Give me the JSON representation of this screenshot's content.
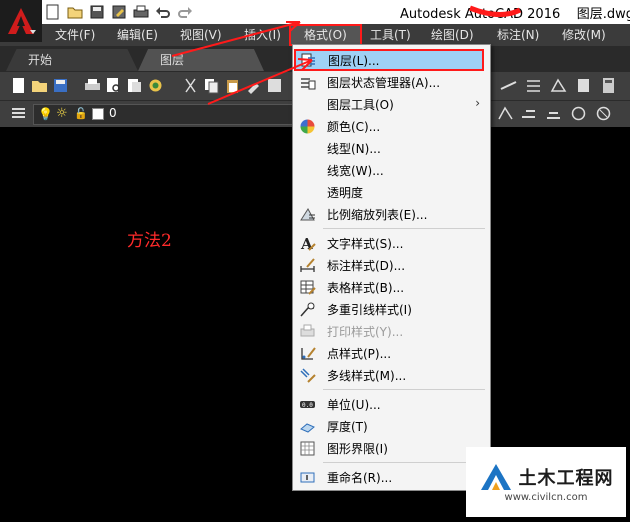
{
  "window": {
    "title": "Autodesk AutoCAD 2016    图层.dwg"
  },
  "quick_access": [
    "new-icon",
    "open-icon",
    "save-icon",
    "saveas-icon",
    "print-icon",
    "undo-icon",
    "redo-icon"
  ],
  "menubar": [
    {
      "label": "文件(F)"
    },
    {
      "label": "编辑(E)"
    },
    {
      "label": "视图(V)"
    },
    {
      "label": "插入(I)"
    },
    {
      "label": "格式(O)",
      "active": true
    },
    {
      "label": "工具(T)"
    },
    {
      "label": "绘图(D)"
    },
    {
      "label": "标注(N)"
    },
    {
      "label": "修改(M)"
    }
  ],
  "tabs": [
    {
      "label": "开始"
    },
    {
      "label": "图层"
    }
  ],
  "layer_toolbar": {
    "current_layer": "0"
  },
  "canvas": {
    "annotation": "方法2"
  },
  "format_menu": {
    "items": [
      {
        "label": "图层(L)...",
        "icon": "layer-icon",
        "highlighted": true
      },
      {
        "label": "图层状态管理器(A)...",
        "icon": "layer-state-icon"
      },
      {
        "label": "图层工具(O)",
        "icon": "none",
        "submenu": true
      },
      {
        "label": "颜色(C)...",
        "icon": "color-wheel-icon"
      },
      {
        "label": "线型(N)...",
        "icon": "none"
      },
      {
        "label": "线宽(W)...",
        "icon": "none"
      },
      {
        "label": "透明度",
        "icon": "none"
      },
      {
        "label": "比例缩放列表(E)...",
        "icon": "scale-list-icon"
      },
      {
        "label": "文字样式(S)...",
        "icon": "text-style-icon"
      },
      {
        "label": "标注样式(D)...",
        "icon": "dim-style-icon"
      },
      {
        "label": "表格样式(B)...",
        "icon": "table-style-icon"
      },
      {
        "label": "多重引线样式(I)",
        "icon": "mleader-style-icon"
      },
      {
        "label": "打印样式(Y)...",
        "icon": "plot-style-icon",
        "disabled": true
      },
      {
        "label": "点样式(P)...",
        "icon": "point-style-icon"
      },
      {
        "label": "多线样式(M)...",
        "icon": "mline-style-icon"
      },
      {
        "label": "单位(U)...",
        "icon": "units-icon"
      },
      {
        "label": "厚度(T)",
        "icon": "thickness-icon"
      },
      {
        "label": "图形界限(I)",
        "icon": "limits-icon"
      },
      {
        "label": "重命名(R)...",
        "icon": "rename-icon"
      }
    ],
    "submenu_arrow": "›"
  },
  "watermark": {
    "title": "土木工程网",
    "url": "www.civilcn.com"
  },
  "colors": {
    "highlight": "#9fd1f5",
    "annotation_red": "#ff1a1a",
    "background": "#000000"
  }
}
